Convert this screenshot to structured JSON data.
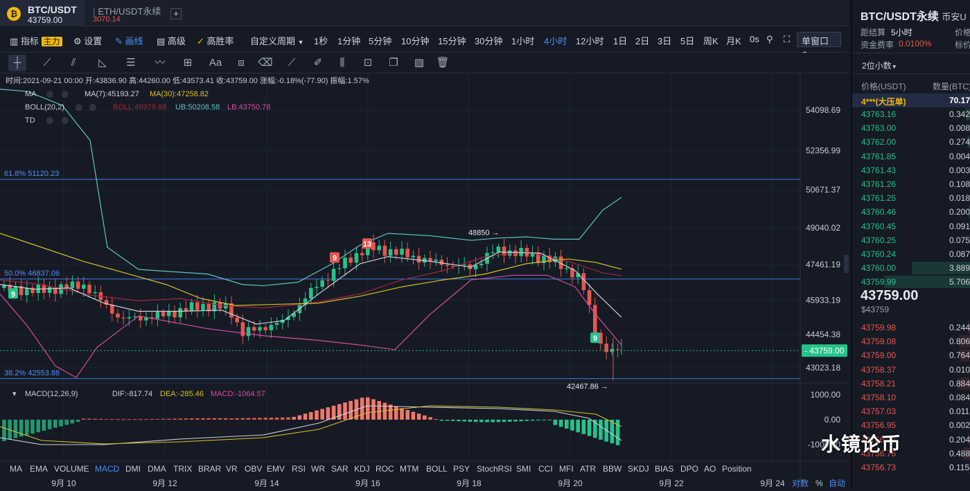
{
  "tabs": {
    "active": {
      "symbol": "BTC/USDT",
      "price": "43759.00",
      "coin_icon": "btc-coin-icon"
    },
    "second": {
      "symbol": "ETH/USDT永续",
      "price": "3070.14"
    },
    "add": "+"
  },
  "toolbar": {
    "indicators": "指标",
    "main_badge": "主力",
    "settings": "设置",
    "draw": "画线",
    "advanced": "高级",
    "winrate": "高胜率",
    "custom_period": "自定义周期",
    "periods": [
      "1秒",
      "1分钟",
      "5分钟",
      "10分钟",
      "15分钟",
      "30分钟",
      "1小时",
      "4小时",
      "12小时",
      "1日",
      "2日",
      "3日",
      "5日",
      "周K",
      "月K",
      "0s"
    ],
    "active_period": "4小时",
    "window_mode": "单窗口"
  },
  "chart": {
    "info_line": "时间:2021-09-21 00:00  开:43836.90  高:44260.00  低:43573.41  收:43759.00  涨幅:-0.18%(-77.90)  振幅:1.57%",
    "ma_label": "MA",
    "ma7": "MA(7):45193.27",
    "ma30": "MA(30):47258.82",
    "boll_label": "BOLL(20,2)",
    "boll_mid": "BOLL:46979.68",
    "boll_ub": "UB:50208.58",
    "boll_lb": "LB:43750.78",
    "td_label": "TD",
    "price_labels": [
      "54098.69",
      "52356.99",
      "50671.37",
      "49040.02",
      "47461.19",
      "45933.19",
      "44454.38",
      "43023.18"
    ],
    "current_price_tag": "43759.00",
    "fib": [
      {
        "label": "61.8% 51120.23",
        "value": 51120.23
      },
      {
        "label": "50.0% 46837.06",
        "value": 46837.06
      },
      {
        "label": "38.2% 42553.88",
        "value": 42553.88
      }
    ],
    "high_marker": "48850",
    "low_marker": "42467.86",
    "td_marks": [
      "9",
      "9",
      "13",
      "9"
    ],
    "macd_label": "MACD(12,26,9)",
    "dif": "DIF:-817.74",
    "dea": "DEA:-285.46",
    "macd": "MACD:-1064.57",
    "macd_axis": [
      "1000.00",
      "0.00",
      "-1000.00"
    ],
    "indicator_tabs": [
      "MA",
      "EMA",
      "VOLUME",
      "MACD",
      "DMI",
      "DMA",
      "TRIX",
      "BRAR",
      "VR",
      "OBV",
      "EMV",
      "RSI",
      "WR",
      "SAR",
      "KDJ",
      "ROC",
      "MTM",
      "BOLL",
      "PSY",
      "StochRSI",
      "SMI",
      "CCI",
      "MFI",
      "ATR",
      "BBW",
      "SKDJ",
      "BIAS",
      "DPO",
      "AO",
      "Position"
    ],
    "active_indicator": "MACD",
    "dates": [
      "9月 10",
      "9月 12",
      "9月 14",
      "9月 16",
      "9月 18",
      "9月 20",
      "9月 22",
      "9月 24"
    ],
    "log_label": "对数",
    "pct_label": "%",
    "auto_label": "自动"
  },
  "right_panel": {
    "symbol": "BTC/USDT永续",
    "exchange": "币安U",
    "settle_label": "距结算",
    "settle_value": "5小时",
    "funding_label": "资金费率",
    "funding_value": "0.0100%",
    "cut_label_1": "价格",
    "cut_label_2": "标价",
    "decimals": "2位小数",
    "col_price": "价格(USDT)",
    "col_qty": "数量(BTC)",
    "big_order": {
      "price": "4***(大压单)",
      "qty": "70.17"
    },
    "asks": [
      {
        "p": "43763.16",
        "q": "0.342"
      },
      {
        "p": "43763.00",
        "q": "0.008"
      },
      {
        "p": "43762.00",
        "q": "0.274"
      },
      {
        "p": "43761.85",
        "q": "0.004"
      },
      {
        "p": "43761.43",
        "q": "0.003"
      },
      {
        "p": "43761.26",
        "q": "0.108"
      },
      {
        "p": "43761.25",
        "q": "0.018"
      },
      {
        "p": "43760.46",
        "q": "0.200"
      },
      {
        "p": "43760.45",
        "q": "0.091"
      },
      {
        "p": "43760.25",
        "q": "0.075"
      },
      {
        "p": "43760.24",
        "q": "0.087"
      },
      {
        "p": "43760.00",
        "q": "3.889"
      },
      {
        "p": "43759.99",
        "q": "5.706"
      }
    ],
    "last_price": "43759.00",
    "last_price_usd": "$43759",
    "bids": [
      {
        "p": "43759.98",
        "q": "0.244"
      },
      {
        "p": "43759.08",
        "q": "0.806"
      },
      {
        "p": "43759.00",
        "q": "0.764"
      },
      {
        "p": "43758.37",
        "q": "0.010"
      },
      {
        "p": "43758.21",
        "q": "0.884"
      },
      {
        "p": "43758.10",
        "q": "0.084"
      },
      {
        "p": "43757.03",
        "q": "0.011"
      },
      {
        "p": "43756.95",
        "q": "0.002"
      },
      {
        "p": "43756.77",
        "q": "0.204"
      },
      {
        "p": "43756.76",
        "q": "0.488"
      },
      {
        "p": "43756.73",
        "q": "0.115"
      }
    ]
  },
  "watermark": "水镜论币",
  "colors": {
    "up": "#26c28a",
    "down": "#e4574e",
    "accent": "#4d8ff5",
    "gold": "#f0b90b"
  }
}
